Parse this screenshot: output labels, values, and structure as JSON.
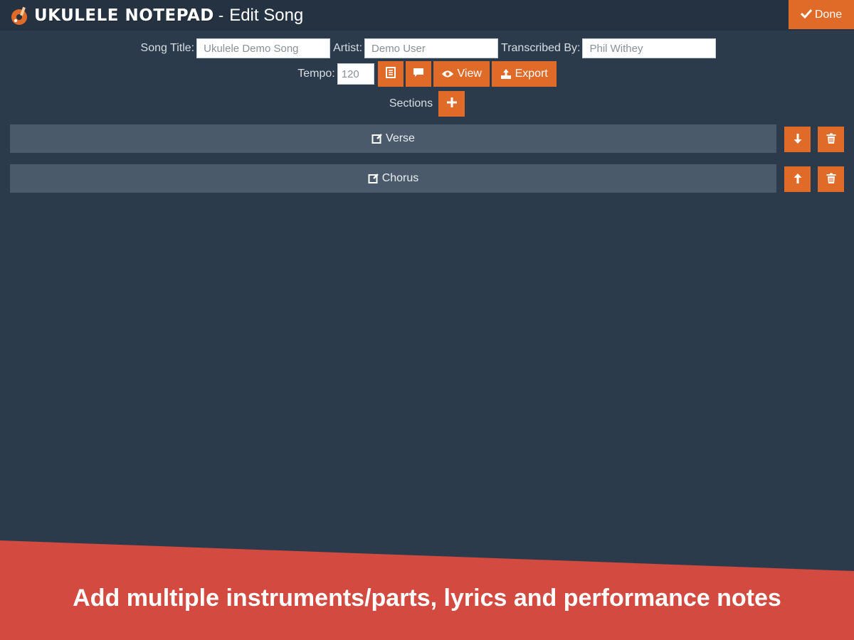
{
  "header": {
    "app_name": "UKULELE NOTEPAD",
    "separator": "-",
    "page_title": "Edit Song",
    "done_label": "Done"
  },
  "form": {
    "song_title_label": "Song Title:",
    "song_title_value": "Ukulele Demo Song",
    "artist_label": "Artist:",
    "artist_value": "Demo User",
    "transcribed_by_label": "Transcribed By:",
    "transcribed_by_value": "Phil Withey",
    "tempo_label": "Tempo:",
    "tempo_value": "120",
    "view_label": "View",
    "export_label": "Export",
    "sections_label": "Sections"
  },
  "sections": [
    {
      "label": "Verse"
    },
    {
      "label": "Chorus"
    }
  ],
  "banner": {
    "text": "Add multiple instruments/parts, lyrics and performance notes"
  },
  "colors": {
    "background": "#2c3b4b",
    "header": "#243241",
    "accent": "#e06a28",
    "section_bar": "#4a5a6a",
    "banner": "#d24a40"
  },
  "icons": {
    "logo": "ukulele-logo-icon",
    "done": "check-icon",
    "notes": "document-icon",
    "comment": "comment-icon",
    "view": "eye-icon",
    "export": "export-icon",
    "add_section": "plus-icon",
    "edit": "edit-icon",
    "move_down": "arrow-down-icon",
    "move_up": "arrow-up-icon",
    "delete": "trash-icon"
  }
}
